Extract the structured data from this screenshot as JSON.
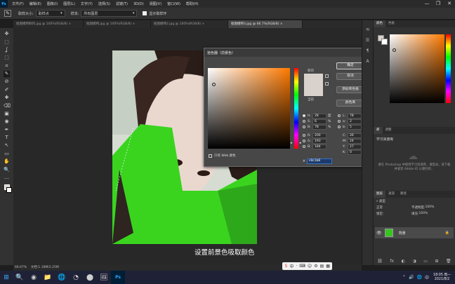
{
  "menubar": {
    "logo": "Ps",
    "items": [
      "文件(F)",
      "编辑(E)",
      "图像(I)",
      "图层(L)",
      "文字(Y)",
      "选择(S)",
      "滤镜(T)",
      "3D(D)",
      "视图(V)",
      "窗口(W)",
      "帮助(H)"
    ],
    "window_controls": [
      "—",
      "❐",
      "✕"
    ]
  },
  "options": {
    "tool_icon": "eyedropper-icon",
    "sample_size_label": "取样大小:",
    "sample_size_value": "取样点",
    "sample_label": "样本:",
    "sample_value": "所有图层",
    "show_ring_label": "显示取样环"
  },
  "tabs": [
    {
      "label": "抠图模特制作.jpg @ 100%(RGB/8) ×",
      "active": false
    },
    {
      "label": "抠图模特.jpg @ 100%(RGB/8) ×",
      "active": false
    },
    {
      "label": "抠图模特2.jpg @ 100%(RGB/8) ×",
      "active": false
    },
    {
      "label": "抠图模特3.jpg @ 66.7%(RGB/8) ×",
      "active": true
    }
  ],
  "toolbar": {
    "tools": [
      "✥",
      "⬚",
      "ʆ",
      "⬚",
      "⌗",
      "✎",
      "⊘",
      "✐",
      "✚",
      "⌫",
      "▣",
      "◉",
      "✒",
      "T",
      "↖",
      "▭",
      "✋",
      "🔍",
      "…"
    ]
  },
  "caption": "设置前景色吸取颜色",
  "status": {
    "zoom": "66.67%",
    "doc": "文档:1.18M/2.25M"
  },
  "picker": {
    "title": "拾色器（前景色）",
    "close": "✕",
    "new_label": "新的",
    "current_label": "当前",
    "buttons": {
      "ok": "确定",
      "cancel": "取消",
      "add_swatch": "添加到色板",
      "libraries": "颜色库"
    },
    "hsb": [
      {
        "label": "H:",
        "value": "28",
        "unit": "度",
        "selected": true
      },
      {
        "label": "S:",
        "value": "6",
        "unit": "%",
        "selected": false
      },
      {
        "label": "B:",
        "value": "78",
        "unit": "%",
        "selected": false
      }
    ],
    "rgb": [
      {
        "label": "R:",
        "value": "200",
        "selected": false
      },
      {
        "label": "G:",
        "value": "193",
        "selected": false
      },
      {
        "label": "B:",
        "value": "184",
        "selected": false
      }
    ],
    "lab": [
      {
        "label": "L:",
        "value": "78",
        "selected": false
      },
      {
        "label": "a:",
        "value": "2",
        "selected": false
      },
      {
        "label": "b:",
        "value": "5",
        "selected": false
      }
    ],
    "cmyk": [
      {
        "label": "C:",
        "value": "26",
        "unit": "%"
      },
      {
        "label": "M:",
        "value": "24",
        "unit": "%"
      },
      {
        "label": "Y:",
        "value": "27",
        "unit": "%"
      },
      {
        "label": "K:",
        "value": "0",
        "unit": "%"
      }
    ],
    "hex_label": "#",
    "hex_value": "c8c1b8",
    "web_only_label": "只有 Web 颜色",
    "new_color": "#d9d2cc",
    "current_color": "#d9d2cc"
  },
  "rpanel": {
    "color_tabs": [
      "颜色",
      "色板"
    ],
    "learn_tabs": [
      "库",
      "调整"
    ],
    "learn_title": "学习资源库",
    "learn_text": "要在 Photoshop 中使用学习资源库，请登录，或下载并安装 Adobe ID 以便同步。",
    "layer_tabs": [
      "图层",
      "通道",
      "路径"
    ],
    "layer_kind": "类型",
    "blend_mode": "正常",
    "opacity_label": "不透明度:",
    "opacity_value": "100%",
    "lock_label": "锁定:",
    "fill_label": "填充:",
    "fill_value": "100%",
    "layer_name": "背景",
    "bottom_icons": [
      "⛓",
      "fx",
      "◐",
      "◑",
      "▭",
      "⊞",
      "🗑"
    ]
  },
  "taskbar": {
    "icons": [
      "🔍",
      "◉",
      "📁",
      "🌐",
      "◔",
      "⬤",
      "🖼",
      "Ps"
    ],
    "tray": [
      "⌃",
      "🔊",
      "🌐",
      "中"
    ],
    "time": "18:05 周一",
    "date": "2021/8/2"
  },
  "ime": [
    "S",
    "中",
    "·",
    "⌨",
    "☺",
    "⚙",
    "▤",
    "▦"
  ],
  "accent": "#31a8ff",
  "foreground_color": "#d9d2cc",
  "green_fill": "#37d11f"
}
